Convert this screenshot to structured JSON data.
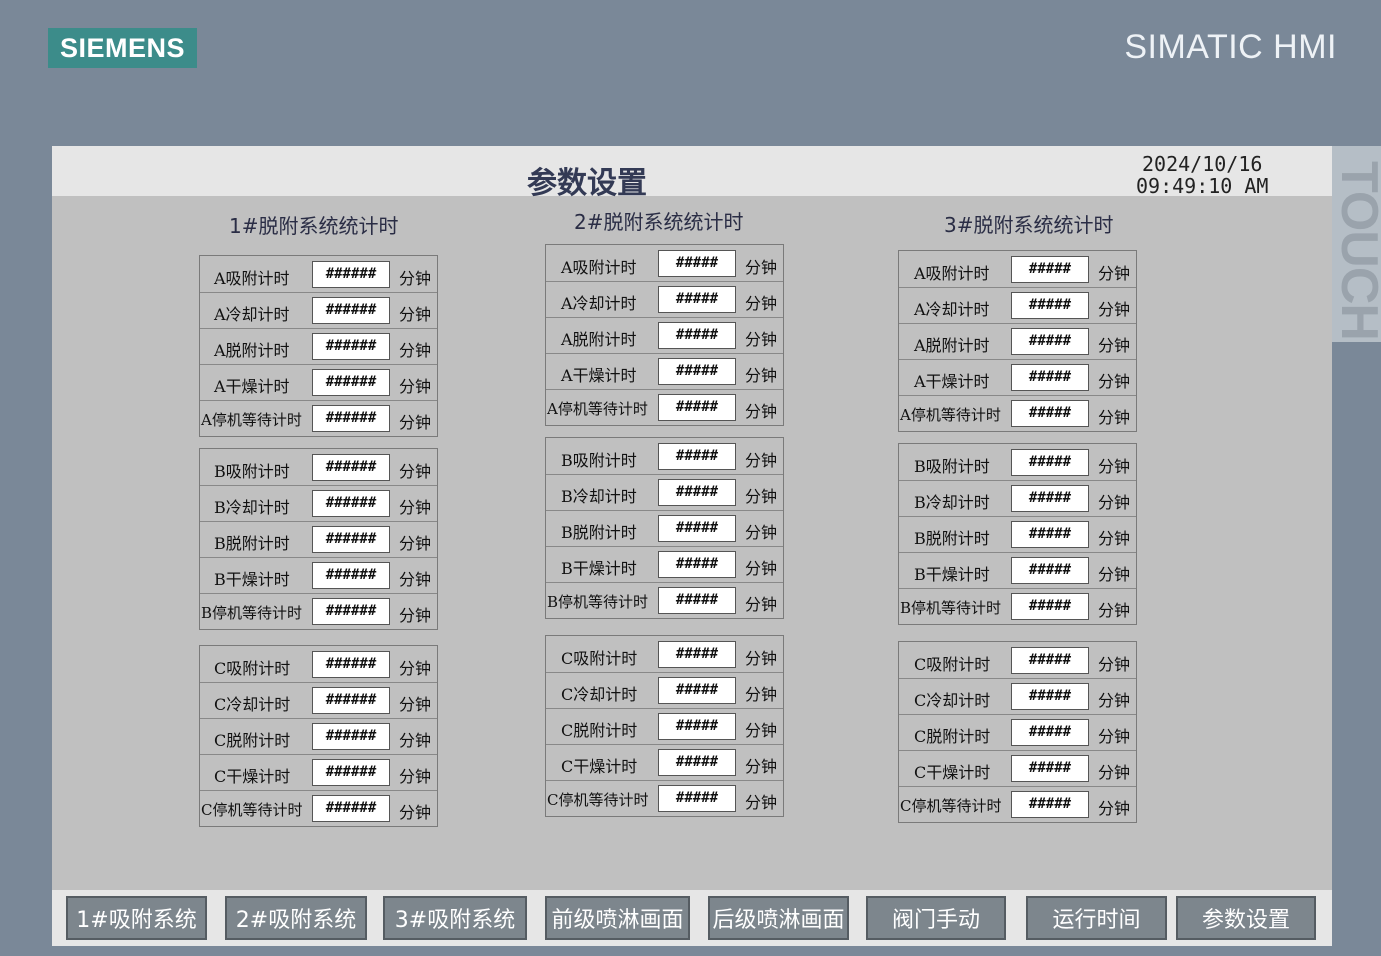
{
  "header": {
    "logo": "SIEMENS",
    "product": "SIMATIC HMI",
    "side_tab": "TOUCH"
  },
  "screen": {
    "title": "参数设置",
    "date": "2024/10/16",
    "time": "09:49:10 AM"
  },
  "columns": [
    {
      "title": "1#脱附系统统计时",
      "value": "######",
      "groups": [
        {
          "rows": [
            {
              "label": "A吸附计时",
              "unit": "分钟"
            },
            {
              "label": "A冷却计时",
              "unit": "分钟"
            },
            {
              "label": "A脱附计时",
              "unit": "分钟"
            },
            {
              "label": "A干燥计时",
              "unit": "分钟"
            },
            {
              "label": "A停机等待计时",
              "unit": "分钟"
            }
          ]
        },
        {
          "rows": [
            {
              "label": "B吸附计时",
              "unit": "分钟"
            },
            {
              "label": "B冷却计时",
              "unit": "分钟"
            },
            {
              "label": "B脱附计时",
              "unit": "分钟"
            },
            {
              "label": "B干燥计时",
              "unit": "分钟"
            },
            {
              "label": "B停机等待计时",
              "unit": "分钟"
            }
          ]
        },
        {
          "rows": [
            {
              "label": "C吸附计时",
              "unit": "分钟"
            },
            {
              "label": "C冷却计时",
              "unit": "分钟"
            },
            {
              "label": "C脱附计时",
              "unit": "分钟"
            },
            {
              "label": "C干燥计时",
              "unit": "分钟"
            },
            {
              "label": "C停机等待计时",
              "unit": "分钟"
            }
          ]
        }
      ]
    },
    {
      "title": "2#脱附系统统计时",
      "value": "#####",
      "groups": [
        {
          "rows": [
            {
              "label": "A吸附计时",
              "unit": "分钟"
            },
            {
              "label": "A冷却计时",
              "unit": "分钟"
            },
            {
              "label": "A脱附计时",
              "unit": "分钟"
            },
            {
              "label": "A干燥计时",
              "unit": "分钟"
            },
            {
              "label": "A停机等待计时",
              "unit": "分钟"
            }
          ]
        },
        {
          "rows": [
            {
              "label": "B吸附计时",
              "unit": "分钟"
            },
            {
              "label": "B冷却计时",
              "unit": "分钟"
            },
            {
              "label": "B脱附计时",
              "unit": "分钟"
            },
            {
              "label": "B干燥计时",
              "unit": "分钟"
            },
            {
              "label": "B停机等待计时",
              "unit": "分钟"
            }
          ]
        },
        {
          "rows": [
            {
              "label": "C吸附计时",
              "unit": "分钟"
            },
            {
              "label": "C冷却计时",
              "unit": "分钟"
            },
            {
              "label": "C脱附计时",
              "unit": "分钟"
            },
            {
              "label": "C干燥计时",
              "unit": "分钟"
            },
            {
              "label": "C停机等待计时",
              "unit": "分钟"
            }
          ]
        }
      ]
    },
    {
      "title": "3#脱附系统统计时",
      "value": "#####",
      "groups": [
        {
          "rows": [
            {
              "label": "A吸附计时",
              "unit": "分钟"
            },
            {
              "label": "A冷却计时",
              "unit": "分钟"
            },
            {
              "label": "A脱附计时",
              "unit": "分钟"
            },
            {
              "label": "A干燥计时",
              "unit": "分钟"
            },
            {
              "label": "A停机等待计时",
              "unit": "分钟"
            }
          ]
        },
        {
          "rows": [
            {
              "label": "B吸附计时",
              "unit": "分钟"
            },
            {
              "label": "B冷却计时",
              "unit": "分钟"
            },
            {
              "label": "B脱附计时",
              "unit": "分钟"
            },
            {
              "label": "B干燥计时",
              "unit": "分钟"
            },
            {
              "label": "B停机等待计时",
              "unit": "分钟"
            }
          ]
        },
        {
          "rows": [
            {
              "label": "C吸附计时",
              "unit": "分钟"
            },
            {
              "label": "C冷却计时",
              "unit": "分钟"
            },
            {
              "label": "C脱附计时",
              "unit": "分钟"
            },
            {
              "label": "C干燥计时",
              "unit": "分钟"
            },
            {
              "label": "C停机等待计时",
              "unit": "分钟"
            }
          ]
        }
      ]
    }
  ],
  "nav": [
    {
      "label": "1#吸附系统"
    },
    {
      "label": "2#吸附系统"
    },
    {
      "label": "3#吸附系统"
    },
    {
      "label": "前级喷淋画面"
    },
    {
      "label": "后级喷淋画面"
    },
    {
      "label": "阀门手动"
    },
    {
      "label": "运行时间"
    },
    {
      "label": "参数设置"
    }
  ]
}
